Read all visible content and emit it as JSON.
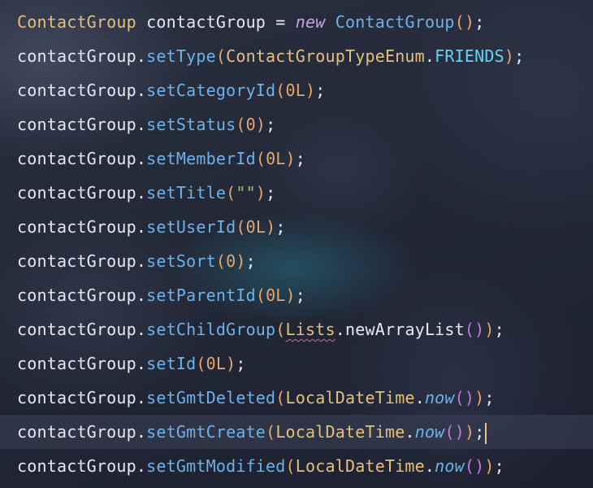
{
  "editor": {
    "lines": [
      {
        "type": "ContactGroup",
        "var": "contactGroup",
        "op": " = ",
        "kw": "new",
        "cls": "ContactGroup",
        "semi": ";"
      },
      {
        "target": "contactGroup",
        "method": "setType",
        "argClass": "ContactGroupTypeEnum",
        "argConst": "FRIENDS",
        "semi": ";"
      },
      {
        "target": "contactGroup",
        "method": "setCategoryId",
        "arg": "0L",
        "semi": ";"
      },
      {
        "target": "contactGroup",
        "method": "setStatus",
        "arg": "0",
        "semi": ";"
      },
      {
        "target": "contactGroup",
        "method": "setMemberId",
        "arg": "0L",
        "semi": ";"
      },
      {
        "target": "contactGroup",
        "method": "setTitle",
        "arg": "\"\"",
        "semi": ";"
      },
      {
        "target": "contactGroup",
        "method": "setUserId",
        "arg": "0L",
        "semi": ";"
      },
      {
        "target": "contactGroup",
        "method": "setSort",
        "arg": "0",
        "semi": ";"
      },
      {
        "target": "contactGroup",
        "method": "setParentId",
        "arg": "0L",
        "semi": ";"
      },
      {
        "target": "contactGroup",
        "method": "setChildGroup",
        "argClass": "Lists",
        "argMethod": "newArrayList",
        "semi": ";"
      },
      {
        "target": "contactGroup",
        "method": "setId",
        "arg": "0L",
        "semi": ";"
      },
      {
        "target": "contactGroup",
        "method": "setGmtDeleted",
        "argClass": "LocalDateTime",
        "argMethod": "now",
        "semi": ";"
      },
      {
        "target": "contactGroup",
        "method": "setGmtCreate",
        "argClass": "LocalDateTime",
        "argMethod": "now",
        "semi": ";"
      },
      {
        "target": "contactGroup",
        "method": "setGmtModified",
        "argClass": "LocalDateTime",
        "argMethod": "now",
        "semi": ";"
      }
    ],
    "punct": {
      "dot": ".",
      "open": "(",
      "close": ")"
    }
  }
}
